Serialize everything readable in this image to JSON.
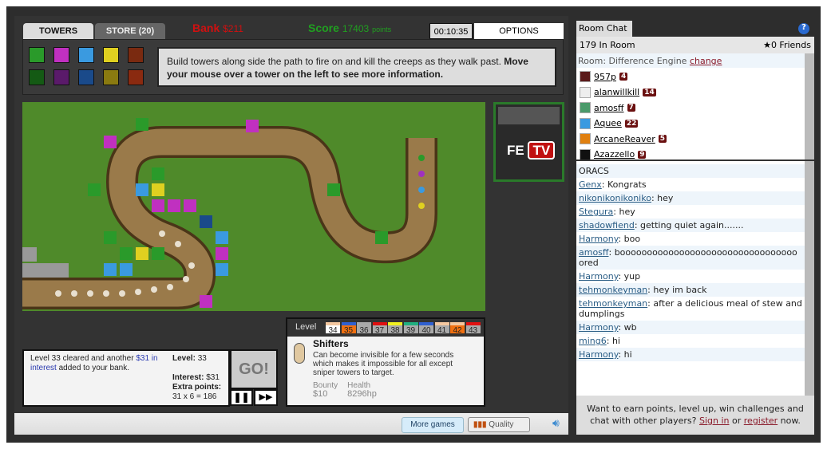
{
  "tabs": {
    "towers": "TOWERS",
    "store": "STORE (20)"
  },
  "bank": {
    "label": "Bank",
    "value": "$211"
  },
  "score": {
    "label": "Score",
    "value": "17403",
    "unit": "points"
  },
  "timer": "00:10:35",
  "options": "OPTIONS",
  "towers": [
    {
      "name": "green-tower",
      "color": "#2a9a2a"
    },
    {
      "name": "pink-tower",
      "color": "#c030c0"
    },
    {
      "name": "blue-tower",
      "color": "#3a9ae0"
    },
    {
      "name": "yellow-tower",
      "color": "#e0d020"
    },
    {
      "name": "red-tower",
      "color": "#7a2a10"
    },
    {
      "name": "dark-green-tower",
      "color": "#145a14"
    },
    {
      "name": "purple-tower",
      "color": "#5a1a6a"
    },
    {
      "name": "dark-blue-tower",
      "color": "#1a4a8a"
    },
    {
      "name": "olive-tower",
      "color": "#8a7a10"
    },
    {
      "name": "dark-red-tower",
      "color": "#8a2a10"
    }
  ],
  "info": {
    "text": "Build towers along side the path to fire on and kill the creeps as they walk past. ",
    "bold": "Move your mouse over a tower on the left to see more information."
  },
  "fetv": {
    "fe": "FE",
    "tv": "TV"
  },
  "status": {
    "pre": "Level 33 cleared and another ",
    "link": "$31 in interest",
    "post": " added to your bank."
  },
  "stats": {
    "level_label": "Level:",
    "level": "33",
    "interest_label": "Interest:",
    "interest": "$31",
    "extra_label": "Extra points:",
    "extra": "31 x 6 = 186"
  },
  "go": "GO!",
  "level_panel": {
    "label": "Level",
    "levels": [
      {
        "n": "34",
        "top": "#f4c8a0",
        "bg": "#fff"
      },
      {
        "n": "35",
        "top": "#3060d0",
        "bg": "#f07010"
      },
      {
        "n": "36",
        "top": "#aaa",
        "bg": "#aaa"
      },
      {
        "n": "37",
        "top": "#e01010",
        "bg": "#aaa"
      },
      {
        "n": "38",
        "top": "#f0f020",
        "bg": "#aaa"
      },
      {
        "n": "39",
        "top": "#20b080",
        "bg": "#aaa"
      },
      {
        "n": "40",
        "top": "#3060d0",
        "bg": "#aaa"
      },
      {
        "n": "41",
        "top": "#f4c8a0",
        "bg": "#aaa"
      },
      {
        "n": "42",
        "top": "#f4c8a0",
        "bg": "#f07010"
      },
      {
        "n": "43",
        "top": "#e01010",
        "bg": "#aaa"
      }
    ],
    "creep": "Shifters",
    "desc": "Can become invisible for a few seconds which makes it impossible for all except sniper towers to target.",
    "bounty_label": "Bounty",
    "bounty": "$10",
    "health_label": "Health",
    "health": "8296hp"
  },
  "bottom": {
    "more_games": "More games",
    "quality": "Quality"
  },
  "chat": {
    "tab": "Room Chat",
    "in_room": "179 In Room",
    "friends": "★0 Friends",
    "room_label": "Room:",
    "room": "Difference Engine",
    "change": "change",
    "users": [
      {
        "name": "957p",
        "lvl": "4",
        "av": "#5a1a1a"
      },
      {
        "name": "alanwillkill",
        "lvl": "14",
        "av": "#eee"
      },
      {
        "name": "amosff",
        "lvl": "7",
        "av": "#4a9a6a"
      },
      {
        "name": "Aquee",
        "lvl": "22",
        "av": "#3a9ae0"
      },
      {
        "name": "ArcaneReaver",
        "lvl": "5",
        "av": "#e08010"
      },
      {
        "name": "Azazzello",
        "lvl": "9",
        "av": "#111"
      }
    ],
    "messages": [
      {
        "u": "",
        "t": "ORACS"
      },
      {
        "u": "Genx",
        "t": "Kongrats"
      },
      {
        "u": "nikonikonikoniko",
        "t": "hey"
      },
      {
        "u": "Stegura",
        "t": "hey"
      },
      {
        "u": "shadowfiend",
        "t": "getting quiet again......."
      },
      {
        "u": "Harmony",
        "t": "boo"
      },
      {
        "u": "amosff",
        "t": "boooooooooooooooooooooooooooooooooored"
      },
      {
        "u": "Harmony",
        "t": "yup"
      },
      {
        "u": "tehmonkeyman",
        "t": "hey im back"
      },
      {
        "u": "tehmonkeyman",
        "t": "after a delicious meal of stew and dumplings"
      },
      {
        "u": "Harmony",
        "t": "wb"
      },
      {
        "u": "ming6",
        "t": "hi"
      },
      {
        "u": "Harmony",
        "t": "hi"
      }
    ],
    "footer_pre": "Want to earn points, level up, win challenges and chat with other players? ",
    "sign_in": "Sign in",
    "or": " or ",
    "register": "register",
    "footer_post": " now."
  }
}
